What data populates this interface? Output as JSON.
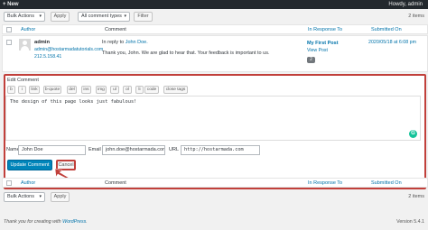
{
  "adminbar": {
    "new": "New",
    "howdy": "Howdy, admin"
  },
  "top_controls": {
    "bulk": "Bulk Actions",
    "apply": "Apply",
    "type": "All comment types",
    "filter": "Filter",
    "count": "2 items"
  },
  "columns": {
    "author": "Author",
    "comment": "Comment",
    "in_response_to": "In Response To",
    "submitted_on": "Submitted On"
  },
  "row": {
    "author_name": "admin",
    "author_email": "admin@hostarmadatutorials.com",
    "author_ip": "212.5.158.41",
    "reply_prefix": "In reply to",
    "reply_to": "John Doe.",
    "text": "Thank you, John. We are glad to hear that. Your feedback is important to us.",
    "post": "My First Post",
    "view_post": "View Post",
    "comment_count": "2",
    "date": "2020/05/18 at 6:08 pm"
  },
  "edit": {
    "title": "Edit Comment",
    "tags": [
      "b",
      "i",
      "link",
      "b-quote",
      "del",
      "ins",
      "img",
      "ul",
      "ol",
      "li",
      "code",
      "close tags"
    ],
    "content": "The design of this page looks just fabulous!",
    "name_label": "Name",
    "name_value": "John Doe",
    "email_label": "Email",
    "email_value": "john.doe@hostarmada.com",
    "url_label": "URL",
    "url_value": "http://hostarmada.com",
    "update": "Update Comment",
    "cancel": "Cancel"
  },
  "bottom_controls": {
    "bulk": "Bulk Actions",
    "apply": "Apply",
    "count": "2 items"
  },
  "footer": {
    "thanks_prefix": "Thank you for creating with ",
    "wp": "WordPress",
    "thanks_suffix": ".",
    "version": "Version 5.4.1"
  },
  "colors": {
    "highlight": "#c1403b",
    "primary": "#0085ba",
    "link": "#0073aa"
  }
}
